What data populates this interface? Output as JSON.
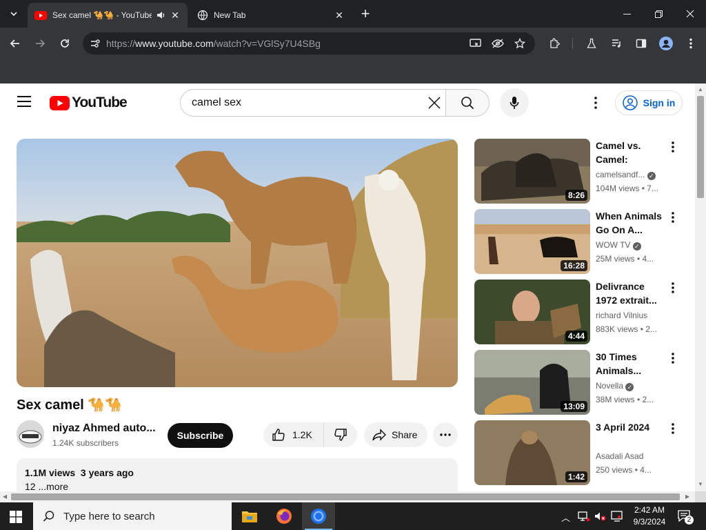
{
  "browser": {
    "tabs": [
      {
        "title": "Sex camel 🐪🐪 - YouTube",
        "active": true
      },
      {
        "title": "New Tab",
        "active": false
      }
    ],
    "url_prefix": "https://",
    "url_domain": "www.youtube.com",
    "url_path": "/watch?v=VGlSy7U4SBg"
  },
  "youtube": {
    "logo_text": "YouTube",
    "search_value": "camel sex",
    "signin_label": "Sign in"
  },
  "video": {
    "title": "Sex camel 🐪🐪",
    "channel": "niyaz Ahmed auto...",
    "subscribers": "1.24K subscribers",
    "subscribe_label": "Subscribe",
    "likes": "1.2K",
    "share_label": "Share",
    "views_date": "1.1M views  3 years ago",
    "desc_preview": "12 ...more"
  },
  "recommendations": [
    {
      "title": "Camel vs. Camel: Anima...",
      "channel": "camelsandf...",
      "verified": true,
      "meta": "104M views  • 7...",
      "duration": "8:26"
    },
    {
      "title": "When Animals Go On A...",
      "channel": "WOW TV",
      "verified": true,
      "meta": "25M views  • 4...",
      "duration": "16:28"
    },
    {
      "title": "Delivrance 1972 extrait...",
      "channel": "richard Vilnius",
      "verified": false,
      "meta": "883K views  • 2...",
      "duration": "4:44"
    },
    {
      "title": "30 Times Animals...",
      "channel": "Novella",
      "verified": true,
      "meta": "38M views  • 2...",
      "duration": "13:09"
    },
    {
      "title": "3 April 2024",
      "channel": "Asadali Asad",
      "verified": false,
      "meta": "250 views  • 4...",
      "duration": "1:42"
    }
  ],
  "taskbar": {
    "search_placeholder": "Type here to search",
    "time": "2:42 AM",
    "date": "9/3/2024",
    "notification_count": "2"
  },
  "colors": {
    "chrome_dark": "#202124",
    "chrome_toolbar": "#35363a",
    "yt_red": "#ff0000",
    "link_blue": "#065fd4"
  }
}
